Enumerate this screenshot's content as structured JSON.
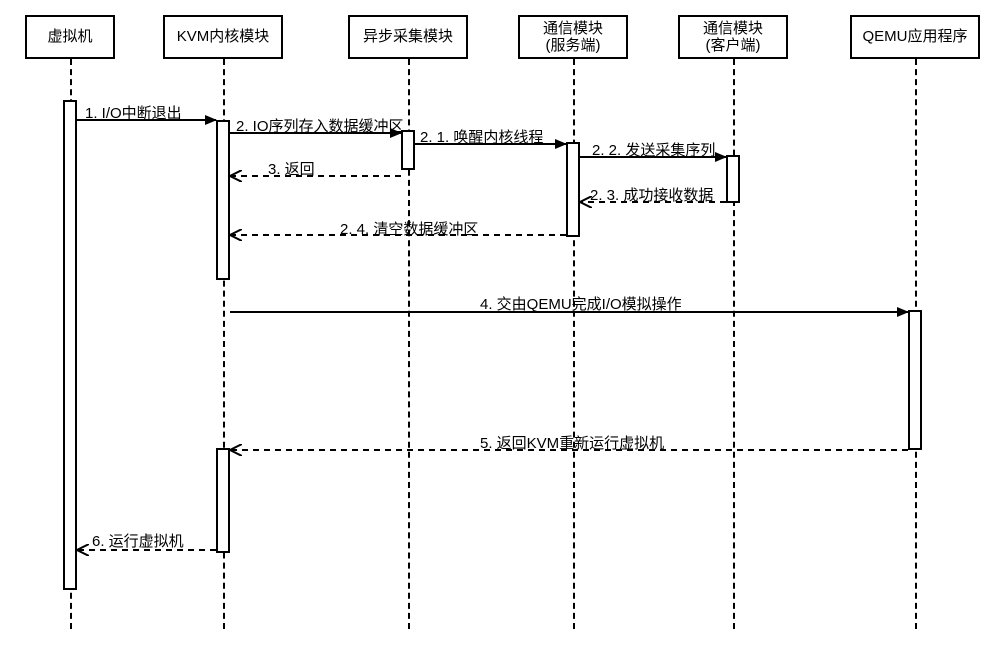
{
  "actors": {
    "a1": "虚拟机",
    "a2": "KVM内核模块",
    "a3": "异步采集模块",
    "a4": "通信模块\n(服务端)",
    "a5": "通信模块\n(客户端)",
    "a6": "QEMU应用程序"
  },
  "messages": {
    "m1": "1. I/O中断退出",
    "m2": "2. IO序列存入数据缓冲区",
    "m21": "2. 1. 唤醒内核线程",
    "m22": "2. 2. 发送采集序列",
    "m3": "3. 返回",
    "m23": "2. 3. 成功接收数据",
    "m24": "2. 4. 清空数据缓冲区",
    "m4": "4. 交由QEMU完成I/O模拟操作",
    "m5": "5. 返回KVM重新运行虚拟机",
    "m6": "6. 运行虚拟机"
  }
}
